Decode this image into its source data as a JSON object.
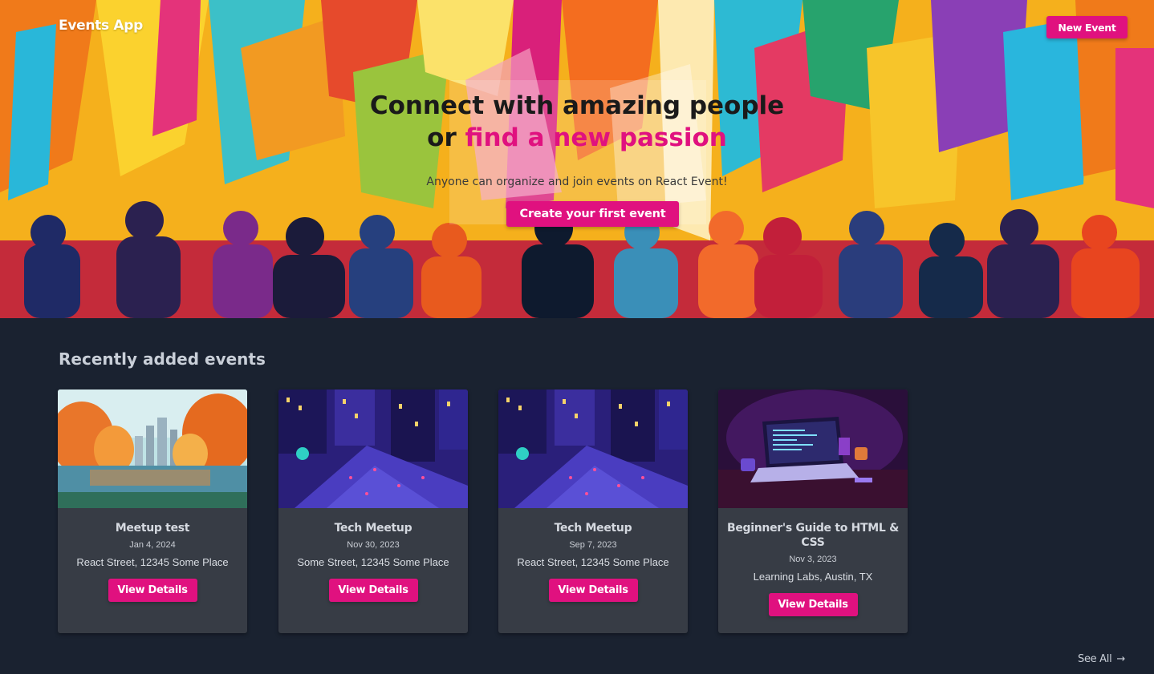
{
  "header": {
    "brand": "Events App",
    "new_event_label": "New Event"
  },
  "hero": {
    "title_line1": "Connect with amazing people",
    "title_line2_prefix": "or",
    "title_line2_highlight": "find a new passion",
    "subtitle": "Anyone can organize and join events on React Event!",
    "cta_label": "Create your first event"
  },
  "events": {
    "section_title": "Recently added events",
    "items": [
      {
        "title": "Meetup test",
        "date": "Jan 4, 2024",
        "location": "React Street, 12345 Some Place",
        "button": "View Details",
        "image": "autumn-park-lake"
      },
      {
        "title": "Tech Meetup",
        "date": "Nov 30, 2023",
        "location": "Some Street, 12345 Some Place",
        "button": "View Details",
        "image": "city-night-crowd"
      },
      {
        "title": "Tech Meetup",
        "date": "Sep 7, 2023",
        "location": "React Street, 12345 Some Place",
        "button": "View Details",
        "image": "city-night-crowd"
      },
      {
        "title": "Beginner's Guide to HTML & CSS",
        "date": "Nov 3, 2023",
        "location": "Learning Labs, Austin, TX",
        "button": "View Details",
        "image": "laptop-desk-neon"
      }
    ],
    "see_all_label": "See All",
    "see_all_icon": "arrow-right-icon"
  },
  "colors": {
    "accent": "#e0117f",
    "page_bg": "#1a2230",
    "card_bg": "#373c45"
  }
}
